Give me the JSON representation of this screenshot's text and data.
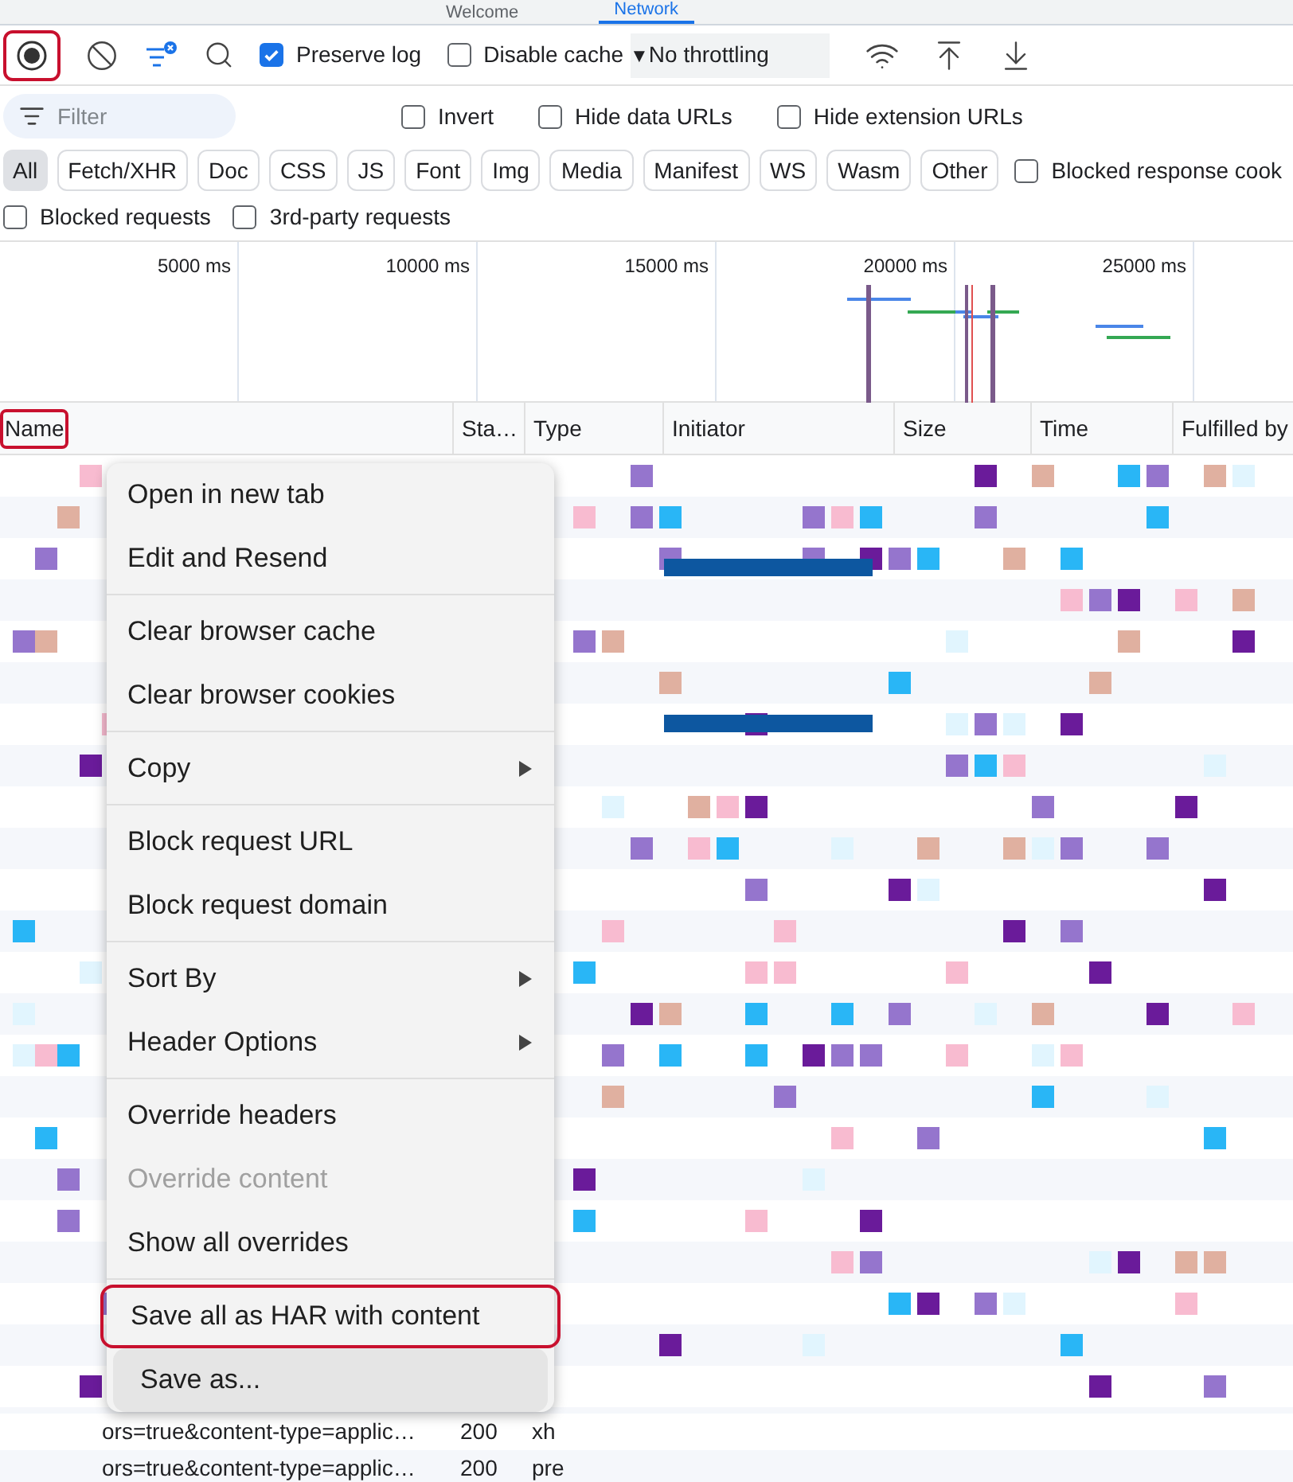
{
  "tab_strip": {
    "tabs": [
      {
        "label": "Welcome",
        "selected": false
      },
      {
        "label": "Network",
        "selected": true
      }
    ]
  },
  "toolbar": {
    "record": {
      "on": true,
      "highlighted": true
    },
    "preserve_log": {
      "label": "Preserve log",
      "checked": true
    },
    "disable_cache": {
      "label": "Disable cache",
      "checked": false
    },
    "throttling_arrow": "▼",
    "throttling": "No throttling"
  },
  "filter": {
    "placeholder": "Filter",
    "options": [
      {
        "label": "Invert",
        "checked": false
      },
      {
        "label": "Hide data URLs",
        "checked": false
      },
      {
        "label": "Hide extension URLs",
        "checked": false
      }
    ]
  },
  "type_filters": [
    {
      "label": "All",
      "selected": true
    },
    {
      "label": "Fetch/XHR",
      "selected": false
    },
    {
      "label": "Doc",
      "selected": false
    },
    {
      "label": "CSS",
      "selected": false
    },
    {
      "label": "JS",
      "selected": false
    },
    {
      "label": "Font",
      "selected": false
    },
    {
      "label": "Img",
      "selected": false
    },
    {
      "label": "Media",
      "selected": false
    },
    {
      "label": "Manifest",
      "selected": false
    },
    {
      "label": "WS",
      "selected": false
    },
    {
      "label": "Wasm",
      "selected": false
    },
    {
      "label": "Other",
      "selected": false
    }
  ],
  "blocked_cookies": {
    "label": "Blocked response cook",
    "checked": false
  },
  "more_filters": [
    {
      "label": "Blocked requests",
      "checked": false
    },
    {
      "label": "3rd-party requests",
      "checked": false
    }
  ],
  "overview": {
    "ticks": [
      "5000 ms",
      "10000 ms",
      "15000 ms",
      "20000 ms",
      "25000 ms"
    ]
  },
  "table": {
    "columns": [
      {
        "label": "Name",
        "highlighted": true
      },
      {
        "label": "Sta…",
        "highlighted": false
      },
      {
        "label": "Type",
        "highlighted": false
      },
      {
        "label": "Initiator",
        "highlighted": false
      },
      {
        "label": "Size",
        "highlighted": false
      },
      {
        "label": "Time",
        "highlighted": false
      },
      {
        "label": "Fulfilled by",
        "highlighted": false
      }
    ],
    "rows": [
      {
        "name": "ors=true&content-type=applic…",
        "status": "200",
        "type": "xh"
      },
      {
        "name": "ors=true&content-type=applic…",
        "status": "200",
        "type": "pre"
      }
    ]
  },
  "context_menu": {
    "groups": [
      [
        {
          "label": "Open in new tab",
          "disabled": false,
          "submenu": false,
          "highlighted": false,
          "hovered": false
        },
        {
          "label": "Edit and Resend",
          "disabled": false,
          "submenu": false,
          "highlighted": false,
          "hovered": false
        }
      ],
      [
        {
          "label": "Clear browser cache",
          "disabled": false,
          "submenu": false,
          "highlighted": false,
          "hovered": false
        },
        {
          "label": "Clear browser cookies",
          "disabled": false,
          "submenu": false,
          "highlighted": false,
          "hovered": false
        }
      ],
      [
        {
          "label": "Copy",
          "disabled": false,
          "submenu": true,
          "highlighted": false,
          "hovered": false
        }
      ],
      [
        {
          "label": "Block request URL",
          "disabled": false,
          "submenu": false,
          "highlighted": false,
          "hovered": false
        },
        {
          "label": "Block request domain",
          "disabled": false,
          "submenu": false,
          "highlighted": false,
          "hovered": false
        }
      ],
      [
        {
          "label": "Sort By",
          "disabled": false,
          "submenu": true,
          "highlighted": false,
          "hovered": false
        },
        {
          "label": "Header Options",
          "disabled": false,
          "submenu": true,
          "highlighted": false,
          "hovered": false
        }
      ],
      [
        {
          "label": "Override headers",
          "disabled": false,
          "submenu": false,
          "highlighted": false,
          "hovered": false
        },
        {
          "label": "Override content",
          "disabled": true,
          "submenu": false,
          "highlighted": false,
          "hovered": false
        },
        {
          "label": "Show all overrides",
          "disabled": false,
          "submenu": false,
          "highlighted": false,
          "hovered": false
        }
      ],
      [
        {
          "label": "Save all as HAR with content",
          "disabled": false,
          "submenu": false,
          "highlighted": true,
          "hovered": false
        },
        {
          "label": "Save as...",
          "disabled": false,
          "submenu": false,
          "highlighted": false,
          "hovered": true
        }
      ]
    ]
  }
}
